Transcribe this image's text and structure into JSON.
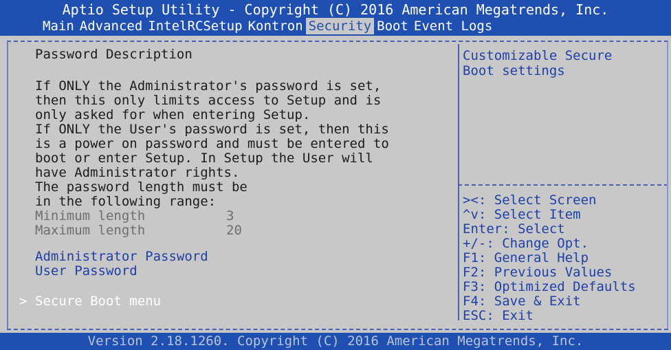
{
  "header": {
    "title": "Aptio Setup Utility - Copyright (C) 2016 American Megatrends, Inc.",
    "tabs": [
      "Main",
      "Advanced",
      "IntelRCSetup",
      "Kontron",
      "Security",
      "Boot",
      "Event Logs"
    ],
    "active_tab": "Security"
  },
  "main": {
    "heading": "Password Description",
    "description": [
      "If ONLY the Administrator's password is set,",
      "then this only limits access to Setup and is",
      "only asked for when entering Setup.",
      "If ONLY the User's password is set, then this",
      "is a power on password and must be entered to",
      "boot or enter Setup. In Setup the User will",
      "have Administrator rights.",
      "The password length must be",
      "in the following range:"
    ],
    "length_rows": [
      {
        "label": "Minimum length",
        "value": "3"
      },
      {
        "label": "Maximum length",
        "value": "20"
      }
    ],
    "items": [
      "Administrator Password",
      "User Password"
    ],
    "submenu_marker": ">",
    "submenu": "Secure Boot menu"
  },
  "help": {
    "description": [
      "Customizable Secure",
      "Boot settings"
    ],
    "keys": [
      "><: Select Screen",
      "^v: Select Item",
      "Enter: Select",
      "+/-: Change Opt.",
      "F1: General Help",
      "F2: Previous Values",
      "F3: Optimized Defaults",
      "F4: Save & Exit",
      "ESC: Exit"
    ]
  },
  "footer": {
    "version": "Version 2.18.1260. Copyright (C) 2016 American Megatrends, Inc."
  },
  "colors": {
    "bar_blue": "#1f4fb0",
    "panel_gray": "#c8c8c8",
    "text_blue": "#1f3fa8",
    "text_dark": "#1c1c1c",
    "text_disabled": "#6e6e6e",
    "selected_white": "#ffffff"
  }
}
